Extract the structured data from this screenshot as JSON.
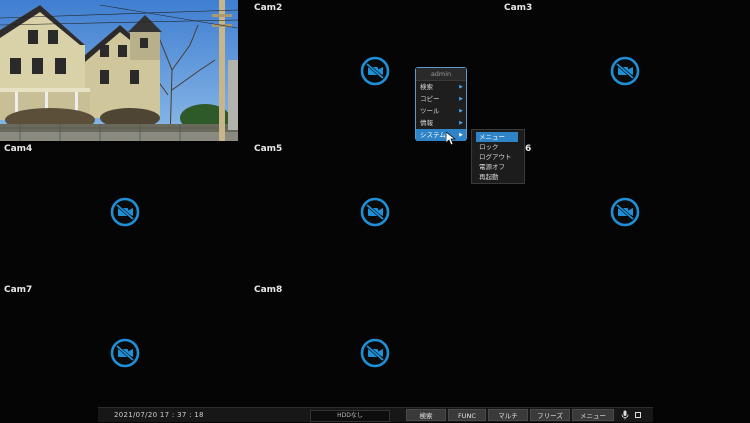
{
  "cameras": [
    {
      "label": "",
      "has_video": true
    },
    {
      "label": "Cam2"
    },
    {
      "label": "Cam3"
    },
    {
      "label": "Cam4"
    },
    {
      "label": "Cam5"
    },
    {
      "label": "6"
    },
    {
      "label": "Cam7"
    },
    {
      "label": "Cam8"
    },
    {
      "label": ""
    }
  ],
  "menu": {
    "title": "admin",
    "items": [
      {
        "label": "検索"
      },
      {
        "label": "コピー"
      },
      {
        "label": "ツール"
      },
      {
        "label": "情報"
      },
      {
        "label": "システム"
      }
    ],
    "submenu": [
      {
        "label": "メニュー"
      },
      {
        "label": "ロック"
      },
      {
        "label": "ログアウト"
      },
      {
        "label": "電源オフ"
      },
      {
        "label": "再起動"
      }
    ]
  },
  "bottombar": {
    "datetime": "2021/07/20  17 : 37 : 18",
    "hdd_status": "HDDなし",
    "buttons": {
      "search": "検索",
      "func": "FUNC",
      "multi": "マルチ",
      "freeze": "フリーズ",
      "menu": "メニュー"
    }
  },
  "colors": {
    "no_camera_icon": "#1f8fd6",
    "menu_highlight": "#2f84c7"
  },
  "icons": {
    "no_camera": "video-off-icon",
    "microphone": "microphone-icon",
    "arrow": "chevron-right-icon"
  }
}
